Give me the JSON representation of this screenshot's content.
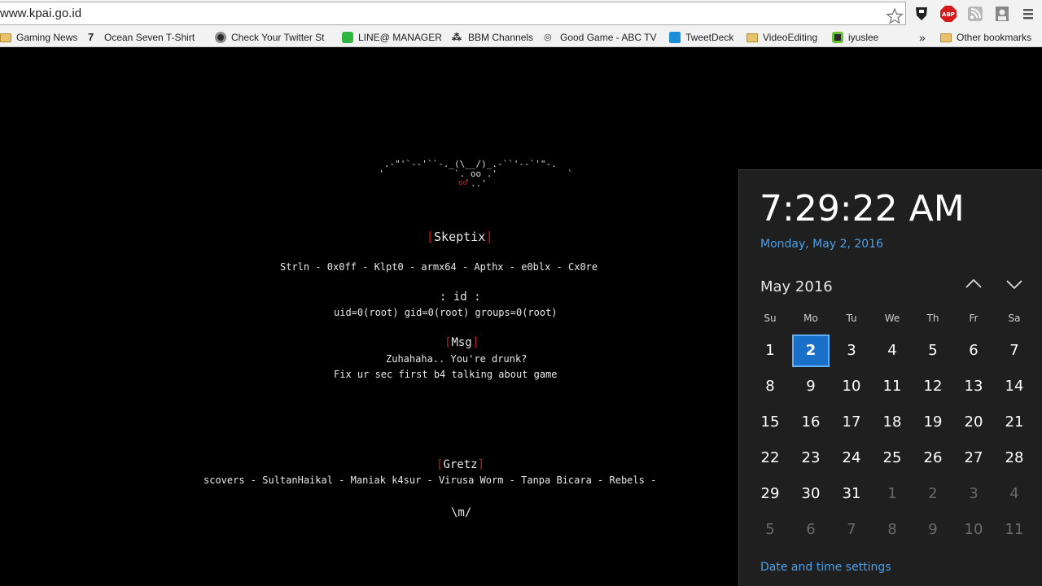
{
  "browser": {
    "url": "www.kpai.go.id",
    "bookmarks": [
      {
        "label": "Gaming News",
        "icon": "folder-icon"
      },
      {
        "label": "Ocean Seven T-Shirt",
        "icon": "seven-icon"
      },
      {
        "label": "Check Your Twitter St",
        "icon": "twitter-check-icon"
      },
      {
        "label": "LINE@ MANAGER",
        "icon": "line-icon"
      },
      {
        "label": "BBM Channels",
        "icon": "bbm-icon"
      },
      {
        "label": "Good Game - ABC TV",
        "icon": "abc-icon"
      },
      {
        "label": "TweetDeck",
        "icon": "tweetdeck-icon"
      },
      {
        "label": "VideoEditing",
        "icon": "folder-icon"
      },
      {
        "label": "iyuslee",
        "icon": "iyuslee-icon"
      }
    ],
    "overflow_label": "»",
    "other_bookmarks": "Other bookmarks"
  },
  "page": {
    "group_open": "[",
    "group_name": "Skeptix",
    "group_close": "]",
    "members": "Strln - 0x0ff - Klpt0 - armx64 - Apthx - e0blx - Cx0re",
    "id_heading": ": id :",
    "id_output": "uid=0(root) gid=0(root) groups=0(root)",
    "msg_heading": "Msg",
    "msg_line1": "Zuhahaha.. You're drunk?",
    "msg_line2": "Fix ur sec first b4 talking about game",
    "gretz_heading": "Gretz",
    "gretz_line": "scovers - SultanHaikal - Maniak k4sur - Virusa Worm - Tanpa Bicara - Rebels -",
    "signoff": "\\m/",
    "bat_art": "   .-\"'`--'``-._(\\__/)_.-``'--`'\"-.\n  '             `. oo .'             `\n                  `..'"
  },
  "clock": {
    "time": "7:29:22 AM",
    "date": "Monday, May 2, 2016",
    "month_label": "May 2016",
    "weekdays": [
      "Su",
      "Mo",
      "Tu",
      "We",
      "Th",
      "Fr",
      "Sa"
    ],
    "weeks": [
      [
        "1",
        "2",
        "3",
        "4",
        "5",
        "6",
        "7"
      ],
      [
        "8",
        "9",
        "10",
        "11",
        "12",
        "13",
        "14"
      ],
      [
        "15",
        "16",
        "17",
        "18",
        "19",
        "20",
        "21"
      ],
      [
        "22",
        "23",
        "24",
        "25",
        "26",
        "27",
        "28"
      ],
      [
        "29",
        "30",
        "31",
        "1",
        "2",
        "3",
        "4"
      ],
      [
        "5",
        "6",
        "7",
        "8",
        "9",
        "10",
        "11"
      ]
    ],
    "today": "2",
    "settings_link": "Date and time settings"
  },
  "colors": {
    "accent_blue": "#4ca0e6",
    "today_blue": "#1a6fc9",
    "bracket_red": "#c01818"
  }
}
